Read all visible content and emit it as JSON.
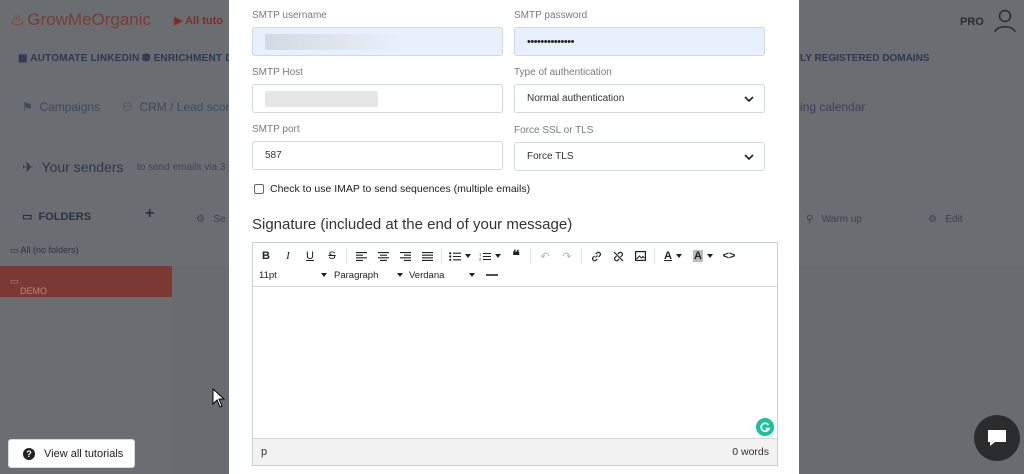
{
  "app": {
    "logo_text": "GrowMeOrganic",
    "all_tutorials_link": "All tuto",
    "plan_badge": "PRO",
    "nav": [
      "AUTOMATE LINKEDIN",
      "ENRICHMENT DA",
      "LY REGISTERED DOMAINS"
    ],
    "subnav": [
      "Campaigns",
      "CRM / Lead scor",
      "ing calendar"
    ],
    "senders_title": "Your senders",
    "senders_sub": "to send emails via 3",
    "folders_label": "FOLDERS",
    "add_folder": "+",
    "all_folders": "All (no folders)",
    "demo_folder": "DEMO",
    "warm_up": "Warm up",
    "edit": "Edit",
    "se_label": "Se"
  },
  "form": {
    "smtp_username_label": "SMTP username",
    "smtp_password_label": "SMTP password",
    "smtp_password_value": "••••••••••••••",
    "smtp_host_label": "SMTP Host",
    "auth_type_label": "Type of authentication",
    "auth_type_value": "Normal authentication",
    "smtp_port_label": "SMTP port",
    "smtp_port_value": "587",
    "ssl_label": "Force SSL or TLS",
    "ssl_value": "Force TLS",
    "imap_checkbox_label": "Check to use IMAP to send sequences (multiple emails)",
    "signature_title": "Signature (included at the end of your message)"
  },
  "editor": {
    "font_size": "11pt",
    "block_format": "Paragraph",
    "font_family": "Verdana",
    "status_path": "p",
    "word_count": "0 words"
  },
  "tutorials_button": "View all tutorials",
  "colors": {
    "overlay": "#6b6e72",
    "autofill": "#e8f0fe",
    "grammarly": "#15c39a",
    "brand_red": "#7a3a33"
  }
}
